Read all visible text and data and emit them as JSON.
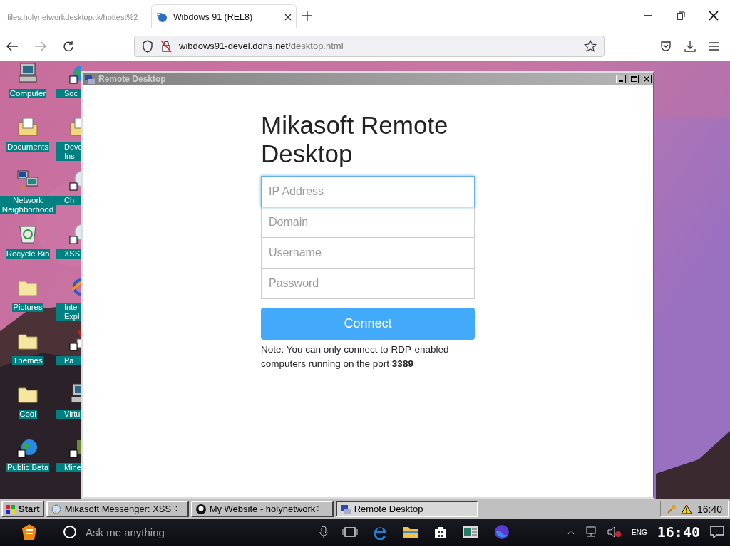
{
  "browser": {
    "tabs": [
      {
        "title": "files.holynetworkdesktop.tk/hottest%2",
        "selected": false
      },
      {
        "title": "Wibdows 91 (REL8)",
        "selected": true
      }
    ],
    "url": {
      "host": "wibdows91-devel.ddns.net",
      "path": "/desktop.html"
    }
  },
  "desktop": {
    "icons": [
      {
        "label": "Computer",
        "kind": "computer"
      },
      {
        "label": "Documents",
        "kind": "docs"
      },
      {
        "label": "Network Neighborhood",
        "kind": "network"
      },
      {
        "label": "Recycle Bin",
        "kind": "recycle"
      },
      {
        "label": "Pictures",
        "kind": "folder"
      },
      {
        "label": "Themes",
        "kind": "folder"
      },
      {
        "label": "Cool",
        "kind": "folder"
      },
      {
        "label": "Public Beta",
        "kind": "globe"
      }
    ],
    "partly_hidden_icons": [
      {
        "label": "Soc",
        "kind": "globe"
      },
      {
        "label": "Deve Ins",
        "kind": "docs"
      },
      {
        "label": "Ch",
        "kind": "bubble"
      },
      {
        "label": "XSS",
        "kind": "bubble"
      },
      {
        "label": "Inte Expl",
        "kind": "ie"
      },
      {
        "label": "Pa",
        "kind": "paint"
      },
      {
        "label": "Virtu",
        "kind": "computer"
      },
      {
        "label": "Mine",
        "kind": "block"
      }
    ]
  },
  "window": {
    "title": "Remote Desktop",
    "heading": "Mikasoft Remote Desktop",
    "fields": [
      {
        "placeholder": "IP Address",
        "focused": true
      },
      {
        "placeholder": "Domain",
        "focused": false
      },
      {
        "placeholder": "Username",
        "focused": false
      },
      {
        "placeholder": "Password",
        "focused": false
      }
    ],
    "button": "Connect",
    "note": "Note: You can only connect to RDP-enabled computers running on the port **3389**"
  },
  "taskbar": {
    "start": "Start",
    "tasks": [
      {
        "label": "Mikasoft Messenger: XSS ÷",
        "kind": "messenger",
        "selected": false
      },
      {
        "label": "My Website - holynetwork÷",
        "kind": "github",
        "selected": false
      },
      {
        "label": "Remote Desktop",
        "kind": "remote",
        "selected": true
      }
    ],
    "clock": "16:40"
  },
  "os_taskbar": {
    "search": {
      "placeholder": "Ask me anything"
    },
    "language": "ENG",
    "clock": "16:40"
  }
}
